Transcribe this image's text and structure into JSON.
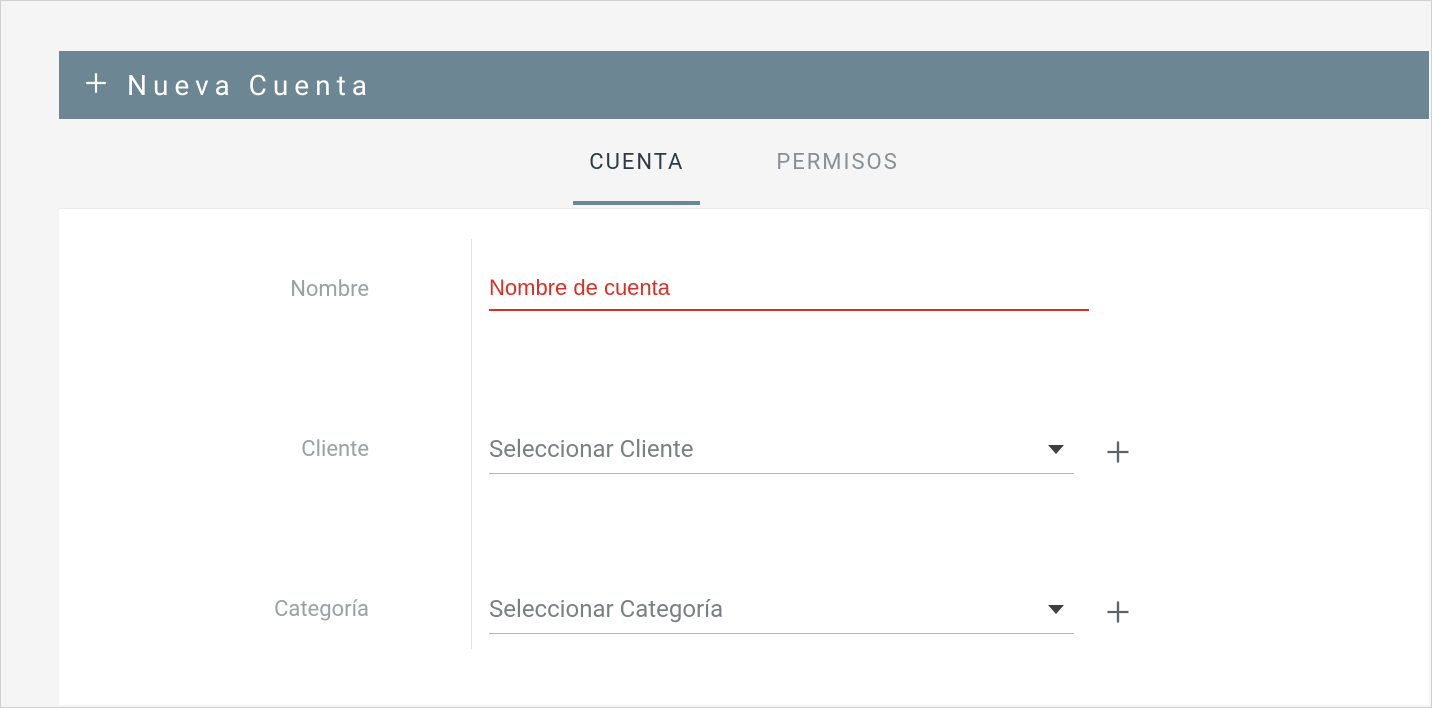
{
  "header": {
    "title": "Nueva Cuenta"
  },
  "tabs": [
    {
      "label": "CUENTA",
      "active": true
    },
    {
      "label": "PERMISOS",
      "active": false
    }
  ],
  "form": {
    "nombre": {
      "label": "Nombre",
      "placeholder": "Nombre de cuenta",
      "value": ""
    },
    "cliente": {
      "label": "Cliente",
      "placeholder": "Seleccionar Cliente",
      "value": ""
    },
    "categoria": {
      "label": "Categoría",
      "placeholder": "Seleccionar Categoría",
      "value": ""
    }
  }
}
